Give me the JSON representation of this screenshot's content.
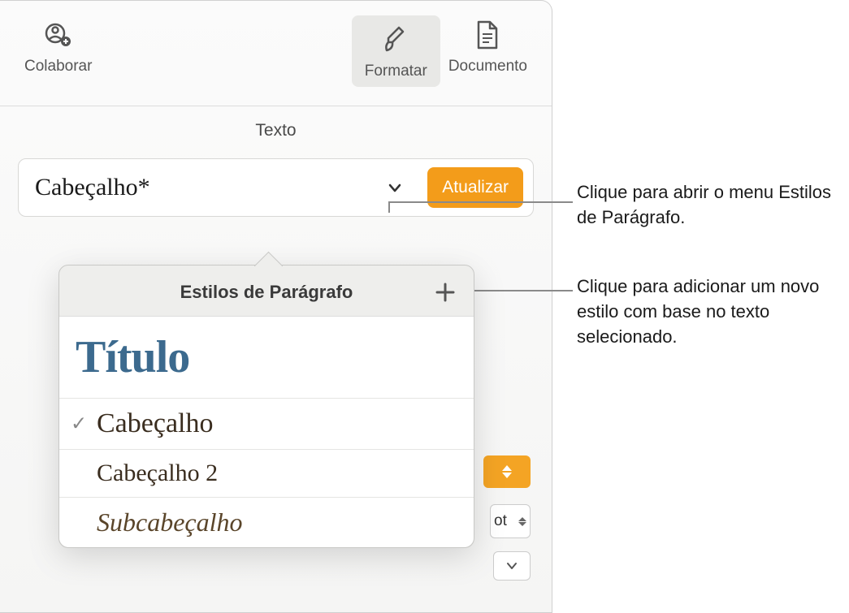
{
  "toolbar": {
    "collaborate_label": "Colaborar",
    "format_label": "Formatar",
    "document_label": "Documento"
  },
  "panel": {
    "tab_text": "Texto",
    "current_style": "Cabeçalho*",
    "update_label": "Atualizar"
  },
  "popover": {
    "title": "Estilos de Parágrafo",
    "styles": {
      "title": "Título",
      "heading": "Cabeçalho",
      "heading2": "Cabeçalho 2",
      "subheading": "Subcabeçalho"
    }
  },
  "peek": {
    "size_suffix": "ot"
  },
  "callouts": {
    "open_menu": "Clique para abrir o menu Estilos de Parágrafo.",
    "add_style": "Clique para adicionar um novo estilo com base no texto selecionado."
  }
}
